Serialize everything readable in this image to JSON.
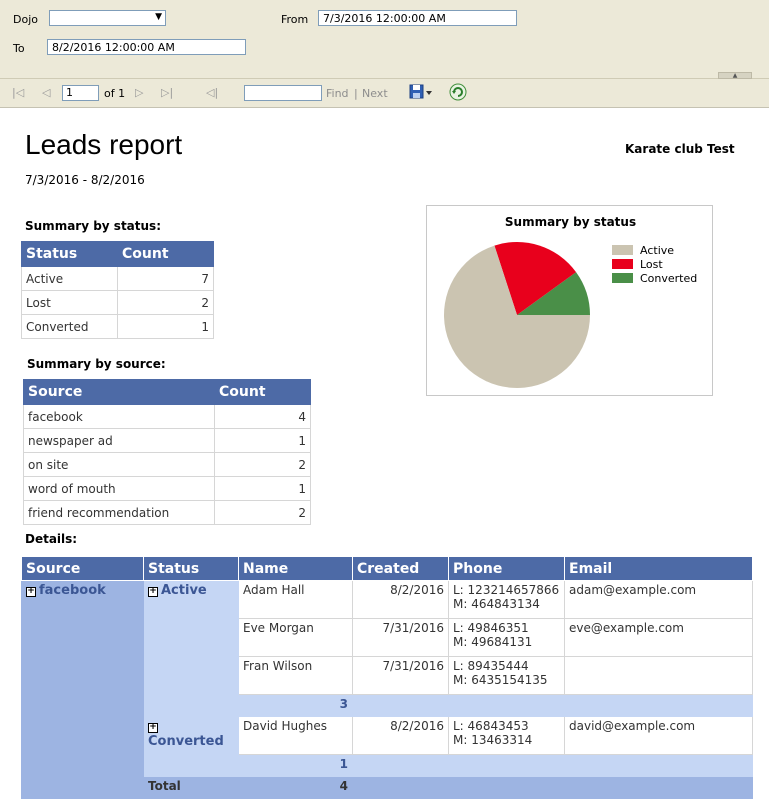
{
  "params": {
    "dojo_label": "Dojo",
    "dojo_value": "",
    "from_label": "From",
    "from_value": "7/3/2016 12:00:00 AM",
    "to_label": "To",
    "to_value": "8/2/2016 12:00:00 AM"
  },
  "toolbar": {
    "page_value": "1",
    "of_pages": "of 1",
    "find_label": "Find",
    "separator": "|",
    "next_label": "Next",
    "find_value": ""
  },
  "report": {
    "title": "Leads report",
    "club": "Karate club Test",
    "date_range": "7/3/2016 - 8/2/2016",
    "status_title": "Summary by status:",
    "status_headers": [
      "Status",
      "Count"
    ],
    "status_rows": [
      {
        "status": "Active",
        "count": "7"
      },
      {
        "status": "Lost",
        "count": "2"
      },
      {
        "status": "Converted",
        "count": "1"
      }
    ],
    "source_title": "Summary by source:",
    "source_headers": [
      "Source",
      "Count"
    ],
    "source_rows": [
      {
        "source": "facebook",
        "count": "4"
      },
      {
        "source": "newspaper ad",
        "count": "1"
      },
      {
        "source": "on site",
        "count": "2"
      },
      {
        "source": "word of mouth",
        "count": "1"
      },
      {
        "source": "friend recommendation",
        "count": "2"
      }
    ],
    "details_title": "Details:",
    "details_headers": [
      "Source",
      "Status",
      "Name",
      "Created",
      "Phone",
      "Email"
    ],
    "details": {
      "source": "facebook",
      "groups": [
        {
          "status": "Active",
          "rows": [
            {
              "name": "Adam Hall",
              "created": "8/2/2016",
              "phone_l": "L: 123214657866",
              "phone_m": "M: 464843134",
              "email": "adam@example.com"
            },
            {
              "name": "Eve Morgan",
              "created": "7/31/2016",
              "phone_l": "L: 49846351",
              "phone_m": "M: 49684131",
              "email": "eve@example.com"
            },
            {
              "name": "Fran Wilson",
              "created": "7/31/2016",
              "phone_l": "L: 89435444",
              "phone_m": "M: 6435154135",
              "email": ""
            }
          ],
          "subtotal": "3"
        },
        {
          "status": "Converted",
          "rows": [
            {
              "name": "David Hughes",
              "created": "8/2/2016",
              "phone_l": "L: 46843453",
              "phone_m": "M: 13463314",
              "email": "david@example.com"
            }
          ],
          "subtotal": "1"
        }
      ],
      "total_label": "Total",
      "total_value": "4"
    }
  },
  "chart_data": {
    "type": "pie",
    "title": "Summary by status",
    "categories": [
      "Active",
      "Lost",
      "Converted"
    ],
    "values": [
      7,
      2,
      1
    ],
    "colors": [
      "#cbc4b1",
      "#e8001c",
      "#4a8f48"
    ],
    "legend": "right"
  }
}
